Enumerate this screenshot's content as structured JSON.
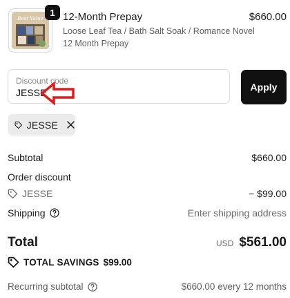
{
  "product": {
    "quantity": "1",
    "title": "12-Month Prepay",
    "variant": "Loose Leaf Tea / Bath Salt Soak / Romance Novel",
    "plan": "12 Month Prepay",
    "price": "$660.00",
    "thumbnail_text": "Best Value"
  },
  "discount": {
    "label": "Discount code",
    "value": "JESSE",
    "apply_label": "Apply"
  },
  "applied_chip": {
    "code": "JESSE"
  },
  "summary": {
    "subtotal_label": "Subtotal",
    "subtotal_value": "$660.00",
    "order_discount_label": "Order discount",
    "discount_code": "JESSE",
    "discount_value": "− $99.00",
    "shipping_label": "Shipping",
    "shipping_value": "Enter shipping address",
    "total_label": "Total",
    "currency": "USD",
    "total_value": "$561.00",
    "savings_label": "TOTAL SAVINGS",
    "savings_value": "$99.00",
    "recurring_label": "Recurring subtotal",
    "recurring_value": "$660.00 every 12 months"
  },
  "colors": {
    "annotation_arrow": "#e01b1b",
    "button_bg": "#111111",
    "chip_bg": "#ebebeb"
  },
  "icons": [
    "tag-icon",
    "close-icon",
    "help-circle-icon",
    "annotation-arrow-icon"
  ]
}
